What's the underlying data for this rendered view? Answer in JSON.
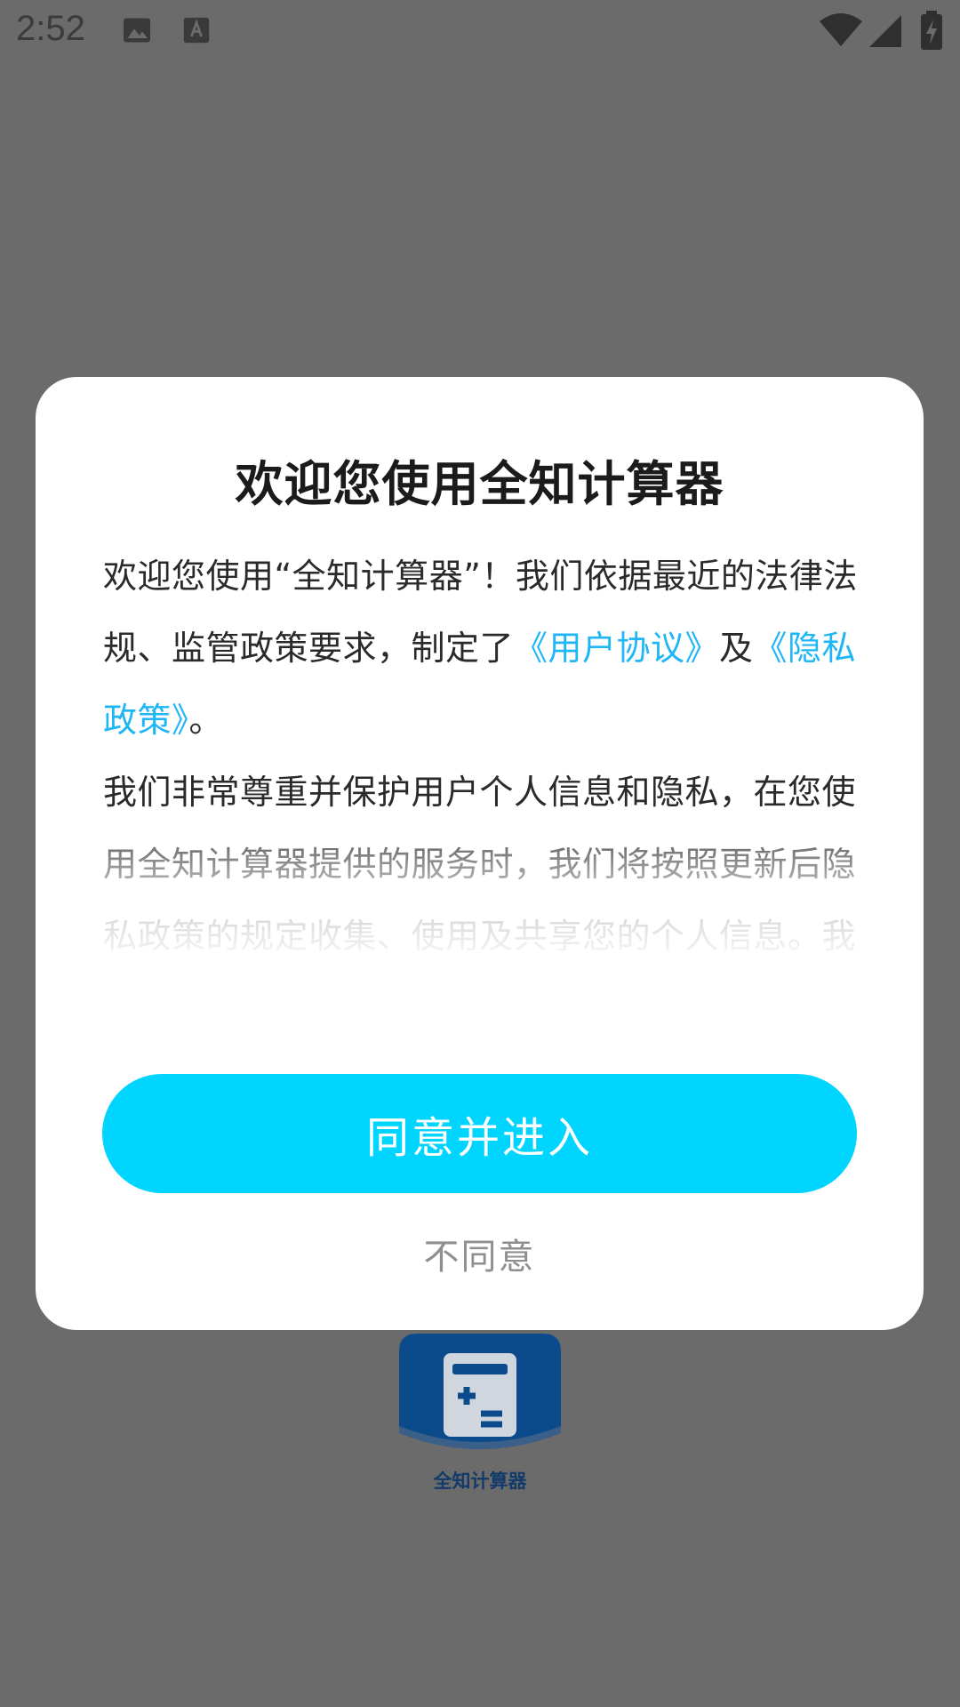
{
  "status_bar": {
    "time": "2:52",
    "icons": [
      "image-icon",
      "text-a-icon",
      "wifi-icon",
      "cellular-icon",
      "battery-charging-icon"
    ]
  },
  "background_app": {
    "name": "全知计算器",
    "logo_color": "#0b4b8c"
  },
  "dialog": {
    "title": "欢迎您使用全知计算器",
    "body": {
      "p1_a": "欢迎您使用“全知计算器”！我们依据最近的法律法规、监管政策要求，制定了",
      "link_user_agreement": "《用户协议》",
      "p1_b": "及",
      "link_privacy_policy": "《隐私政策》",
      "p1_c": "。",
      "p2": "我们非常尊重并保护用户个人信息和隐私，在您使用全知计算器提供的服务时，我们将按照更新后隐私政策的规定收集、使用及共享您的个人信息。我们建议您务必仔细阅读并透彻理解《用户协议》及《隐私政策》中所有条款"
    },
    "agree_label": "同意并进入",
    "decline_label": "不同意"
  },
  "colors": {
    "accent": "#00d5ff",
    "link": "#1fb6f5",
    "overlay": "#6b6b6b"
  }
}
